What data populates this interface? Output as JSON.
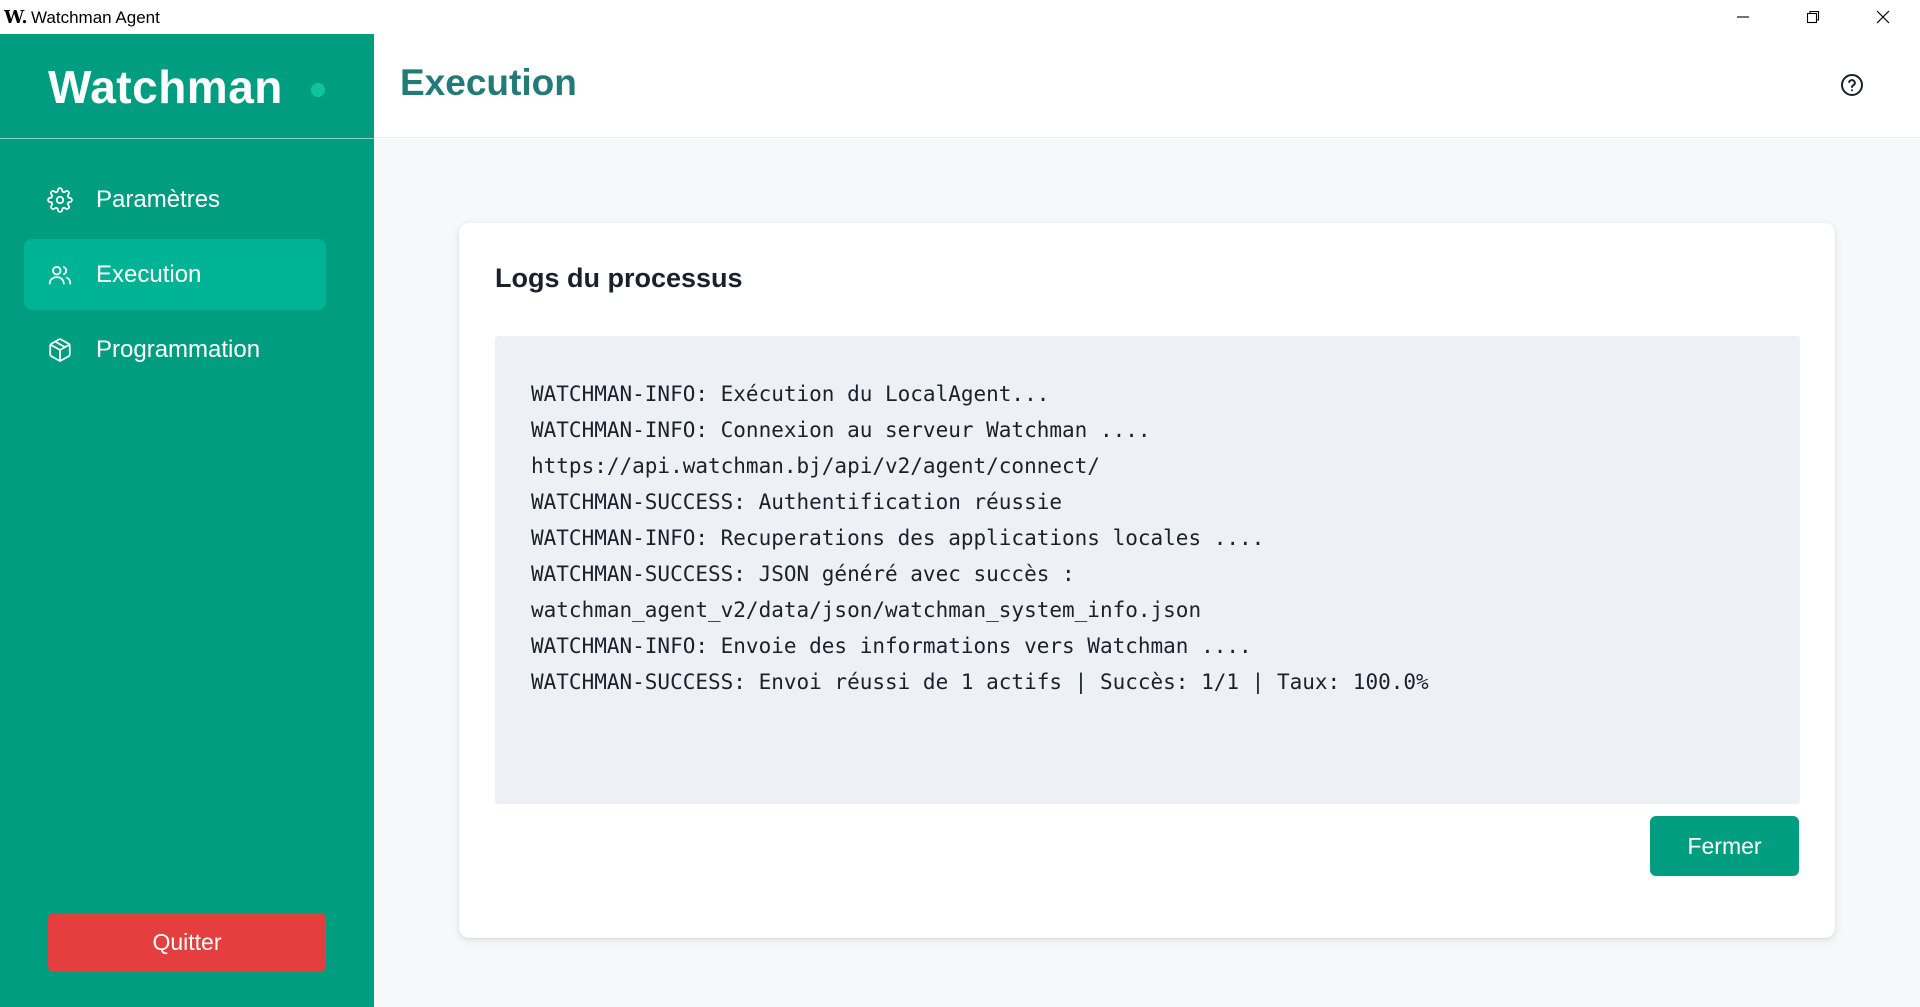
{
  "window": {
    "icon_glyph": "W.",
    "title": "Watchman Agent",
    "controls": [
      "minimize-icon",
      "maximize-icon",
      "close-icon"
    ]
  },
  "sidebar": {
    "logo": "Watchman",
    "items": [
      {
        "label": "Paramètres",
        "icon": "gear-icon",
        "active": false
      },
      {
        "label": "Execution",
        "icon": "users-icon",
        "active": true
      },
      {
        "label": "Programmation",
        "icon": "box-icon",
        "active": false
      }
    ],
    "quit_label": "Quitter"
  },
  "header": {
    "title": "Execution",
    "help_icon": "help-circle-icon"
  },
  "logs": {
    "title": "Logs du processus",
    "lines": [
      "WATCHMAN-INFO: Exécution du LocalAgent...",
      "WATCHMAN-INFO: Connexion au serveur Watchman ....",
      "https://api.watchman.bj/api/v2/agent/connect/",
      "WATCHMAN-SUCCESS: Authentification réussie",
      "WATCHMAN-INFO: Recuperations des applications locales ....",
      "WATCHMAN-SUCCESS: JSON généré avec succès :",
      "watchman_agent_v2/data/json/watchman_system_info.json",
      "WATCHMAN-INFO: Envoie des informations vers Watchman ....",
      "WATCHMAN-SUCCESS: Envoi réussi de 1 actifs | Succès: 1/1 | Taux: 100.0%"
    ],
    "close_label": "Fermer"
  },
  "colors": {
    "brand": "#009d80",
    "nav_active": "#00b394",
    "title_teal": "#227b77",
    "quit_red": "#e53e3e",
    "log_bg": "#edf1f5"
  }
}
